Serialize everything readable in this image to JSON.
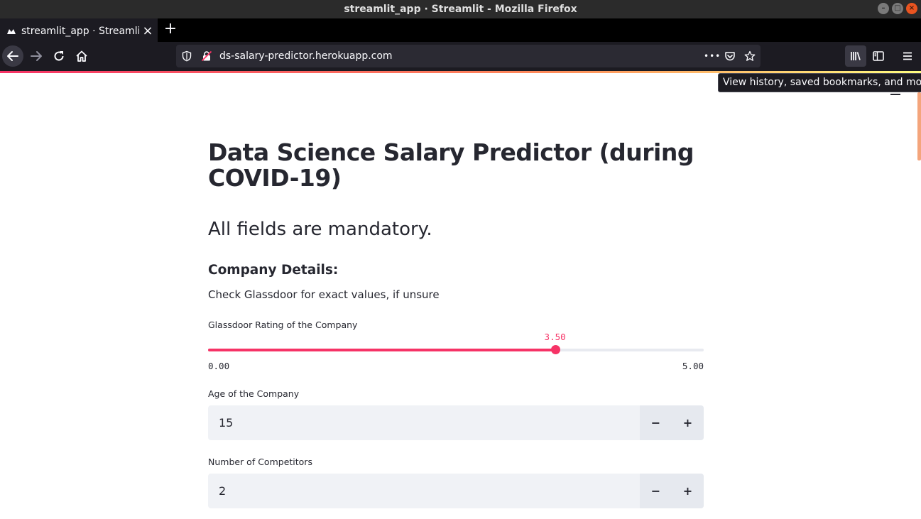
{
  "window": {
    "title": "streamlit_app · Streamlit - Mozilla Firefox",
    "controls": {
      "minimize": "–",
      "maximize": "□",
      "close": "×"
    }
  },
  "tab": {
    "title": "streamlit_app · Streamlit",
    "close": "×",
    "new_tab": "+"
  },
  "navbar": {
    "url": "ds-salary-predictor.herokuapp.com",
    "page_actions": "•••"
  },
  "tooltip": "View history, saved bookmarks, and more",
  "page": {
    "title": "Data Science Salary Predictor (during COVID-19)",
    "subtitle": "All fields are mandatory.",
    "section_heading": "Company Details:",
    "section_note": "Check Glassdoor for exact values, if unsure",
    "rating": {
      "label": "Glassdoor Rating of the Company",
      "value": 3.5,
      "value_label": "3.50",
      "min": 0,
      "max": 5,
      "min_label": "0.00",
      "max_label": "5.00"
    },
    "age": {
      "label": "Age of the Company",
      "value": "15",
      "decrement": "−",
      "increment": "+"
    },
    "competitors": {
      "label": "Number of Competitors",
      "value": "2",
      "decrement": "−",
      "increment": "+"
    }
  },
  "colors": {
    "primary": "#f63366",
    "text": "#262730",
    "input_bg": "#f0f2f6"
  }
}
